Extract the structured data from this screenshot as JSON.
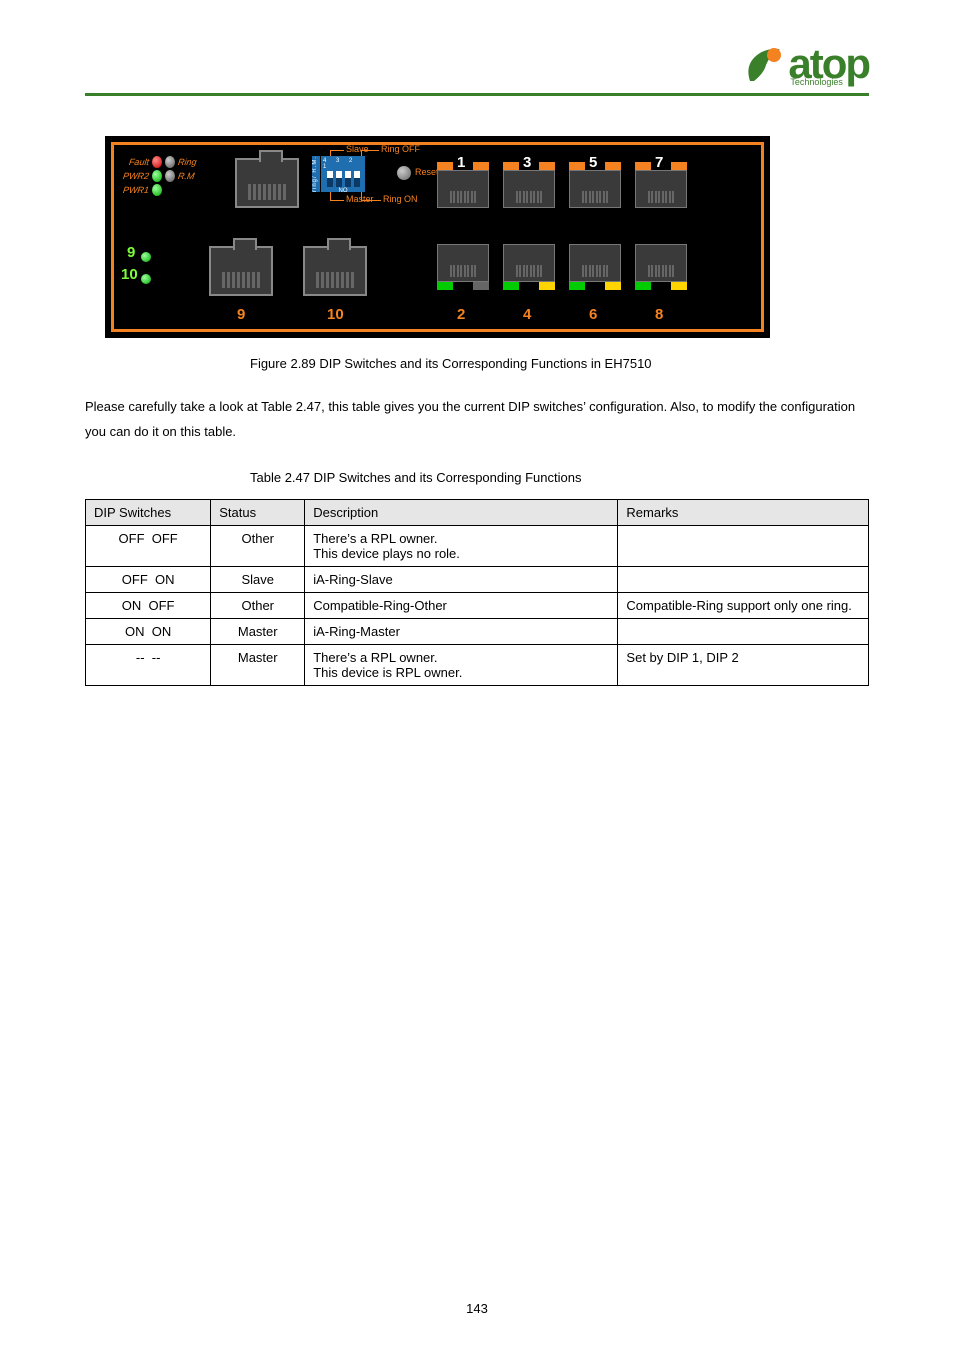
{
  "logo": {
    "word": "atop",
    "sub": "Technologies"
  },
  "diagram": {
    "callouts": {
      "slave": "Slave",
      "ringoff": "Ring OFF",
      "master": "Master",
      "ringon": "Ring ON",
      "reset": "Reset",
      "no": "NO"
    },
    "dip_side": "ring/ R.M.",
    "dip_nums": "4  3  2  1",
    "leds": {
      "r1a": "Fault",
      "r1b": "Ring",
      "r2a": "PWR2",
      "r2b": "R.M",
      "r3a": "PWR1"
    },
    "top_nums": [
      "1",
      "3",
      "5",
      "7"
    ],
    "bot_nums": [
      "2",
      "4",
      "6",
      "8"
    ],
    "big_nums": {
      "nine": "9",
      "ten": "10"
    },
    "side_nums": {
      "nine": "9",
      "ten": "10"
    }
  },
  "caption": "Figure 2.89 DIP Switches and its Corresponding Functions in EH7510",
  "para1_a": "Please carefully take a look at ",
  "para1_b": ", this table gives you the current DIP switches’ configuration. Also, to modify the configuration you can do it on this table.",
  "table_ref": "Table 2.47",
  "para2": "Table 2.47 DIP Switches and its Corresponding Functions",
  "table": {
    "headers": [
      "DIP Switches",
      "Status",
      "Description",
      "Remarks"
    ],
    "rows": [
      {
        "dip": "OFF  OFF",
        "status": "Other",
        "desc": "There’s a RPL owner.\nThis device plays no role.",
        "remarks": ""
      },
      {
        "dip": "OFF  ON",
        "status": "Slave",
        "desc": "iA-Ring-Slave",
        "remarks": ""
      },
      {
        "dip": "ON  OFF",
        "status": "Other",
        "desc": "Compatible-Ring-Other",
        "remarks": "Compatible-Ring support only one ring."
      },
      {
        "dip": "ON  ON",
        "status": "Master",
        "desc": "iA-Ring-Master",
        "remarks": ""
      },
      {
        "dip": "--  --",
        "status": "Master",
        "desc": "There’s a RPL owner.\nThis device is RPL owner.",
        "remarks": "Set by DIP 1, DIP 2"
      }
    ]
  },
  "footer": "143"
}
